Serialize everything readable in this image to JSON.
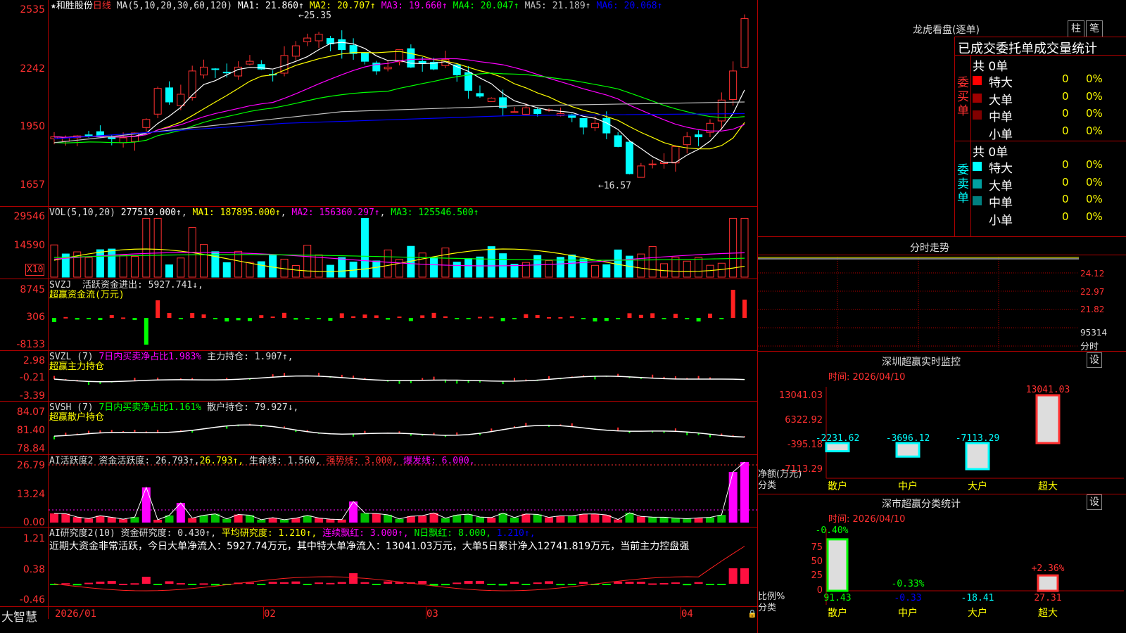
{
  "stock": {
    "star": "★",
    "name": "和胜股份",
    "period": "日线",
    "ma_params": "MA(5,10,20,30,60,120)",
    "ma": [
      {
        "label": "MA1: 21.860↑",
        "color": "#ffffff"
      },
      {
        "label": "MA2: 20.707↑",
        "color": "#ffff00"
      },
      {
        "label": "MA3: 19.660↑",
        "color": "#ff00ff"
      },
      {
        "label": "MA4: 20.047↑",
        "color": "#00ff00"
      },
      {
        "label": "MA5: 21.189↑",
        "color": "#c0c0c0"
      },
      {
        "label": "MA6: 20.068↑",
        "color": "#0000ff"
      }
    ],
    "high_label": "←25.35",
    "low_label": "←16.57"
  },
  "price_axis": [
    "2535",
    "2242",
    "1950",
    "1657"
  ],
  "vol": {
    "header": "VOL(5,10,20)",
    "value": "277519.000↑",
    "ma1": "MA1: 187895.000↑",
    "ma2": "MA2: 156360.297↑",
    "ma3": "MA3: 125546.500↑",
    "axis": [
      "29546",
      "14590"
    ],
    "unit": "X10"
  },
  "svzj": {
    "title": "SVZJ",
    "label": "活跃资金进出:",
    "value": "5927.741↓,",
    "sub": "超赢资金流(万元)",
    "axis": [
      "8745",
      "306",
      "-8133"
    ]
  },
  "svzl": {
    "title": "SVZL (7)",
    "label": "7日内买卖净占比1.983%",
    "hold": "主力持仓: 1.907↑,",
    "sub": "超赢主力持仓",
    "axis": [
      "2.98",
      "-0.21",
      "-3.39"
    ]
  },
  "svsh": {
    "title": "SVSH (7)",
    "label": "7日内买卖净占比1.161%",
    "hold": "散户持仓: 79.927↓,",
    "sub": "超赢散户持仓",
    "axis": [
      "84.07",
      "81.40",
      "78.84"
    ]
  },
  "ai1": {
    "title": "AI活跃度2",
    "label": "资金活跃度: 26.793↑,",
    "v2": "26.793↑,",
    "life": "生命线: 1.560,",
    "strong": "强势线: 3.000,",
    "burst": "爆发线: 6.000,",
    "axis": [
      "26.79",
      "13.24",
      "0.00"
    ]
  },
  "ai2": {
    "title": "AI研究度2(10)",
    "label": "资金研究度: 0.430↑,",
    "avg": "平均研究度: 1.210↑,",
    "red": "连续飘红: 3.000↑,",
    "nred": "N日飘红: 8.000,",
    "last": "1.210↑,",
    "note": "近期大资金非常活跃，今日大单净流入：5927.74万元，其中特大单净流入：13041.03万元，大单5日累计净入12741.819万元，当前主力控盘强",
    "axis": [
      "1.21",
      "0.38",
      "-0.46"
    ]
  },
  "dates": [
    "2026/01",
    "02",
    "03",
    "04"
  ],
  "brand": "大智慧",
  "right": {
    "title": "龙虎看盘(逐单)",
    "btn1": "柱",
    "btn2": "笔",
    "header": "已成交委托单成交量统计",
    "buy": {
      "label": "委买单",
      "count": "共 0单",
      "rows": [
        {
          "name": "特大",
          "color": "#ff0000",
          "v": "0",
          "p": "0%"
        },
        {
          "name": "大单",
          "color": "#a00000",
          "v": "0",
          "p": "0%"
        },
        {
          "name": "中单",
          "color": "#800000",
          "v": "0",
          "p": "0%"
        },
        {
          "name": "小单",
          "color": "#000000",
          "v": "0",
          "p": "0%"
        }
      ]
    },
    "sell": {
      "label": "委卖单",
      "count": "共 0单",
      "rows": [
        {
          "name": "特大",
          "color": "#00ffff",
          "v": "0",
          "p": "0%"
        },
        {
          "name": "大单",
          "color": "#00a0a0",
          "v": "0",
          "p": "0%"
        },
        {
          "name": "中单",
          "color": "#008080",
          "v": "0",
          "p": "0%"
        },
        {
          "name": "小单",
          "color": "#000000",
          "v": "0",
          "p": "0%"
        }
      ]
    },
    "fenshi": {
      "title": "分时走势",
      "axis": [
        "24.12",
        "22.97",
        "21.82",
        "95314"
      ],
      "unit": "分时"
    },
    "sz_monitor": {
      "title": "深圳超赢实时监控",
      "btn": "设",
      "time": "时间: 2026/04/10",
      "axis": [
        "13041.03",
        "6322.92",
        "-395.18",
        "-7113.29"
      ],
      "ylabel": "净额(万元)",
      "xlabel": "分类",
      "bars": [
        {
          "name": "散户",
          "value": -2231.62,
          "label": "-2231.62"
        },
        {
          "name": "中户",
          "value": -3696.12,
          "label": "-3696.12"
        },
        {
          "name": "大户",
          "value": -7113.29,
          "label": "-7113.29"
        },
        {
          "name": "超大",
          "value": 13041.03,
          "label": "13041.03"
        }
      ]
    },
    "sz_class": {
      "title": "深市超赢分类统计",
      "btn": "设",
      "time": "时间: 2026/04/10",
      "axis": [
        "75",
        "50",
        "25",
        "0"
      ],
      "ylabel": "比例%",
      "xlabel": "分类",
      "bars": [
        {
          "name": "散户",
          "value": 91.43,
          "label": "91.43",
          "delta": "-0.40%"
        },
        {
          "name": "中户",
          "value": -0.33,
          "label": "-0.33",
          "delta": "-0.33%"
        },
        {
          "name": "大户",
          "value": -18.41,
          "label": "-18.41",
          "delta": ""
        },
        {
          "name": "超大",
          "value": 27.31,
          "label": "27.31",
          "delta": "+2.36%"
        }
      ]
    }
  },
  "colors": {
    "up": "#ff3030",
    "down": "#00ffff",
    "grid": "#b00000",
    "axis": "#ff3030"
  }
}
